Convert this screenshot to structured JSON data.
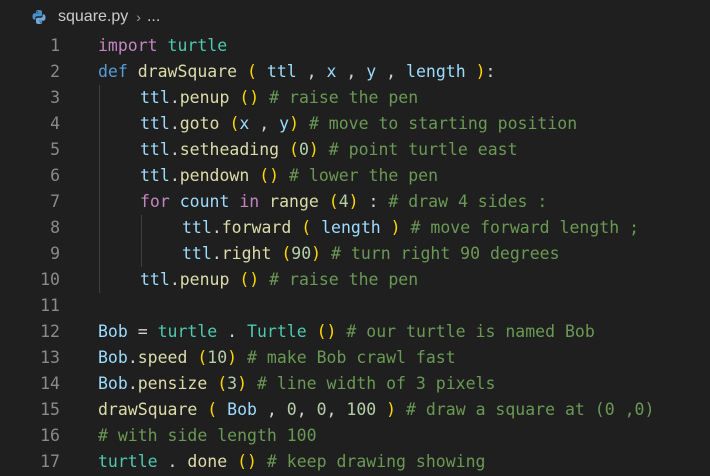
{
  "breadcrumb": {
    "filename": "square.py",
    "separator": "›",
    "more": "..."
  },
  "icons": {
    "file_icon": "python-icon"
  },
  "colors": {
    "background": "#1f1f1f",
    "keyword": "#c586c0",
    "def_keyword": "#569cd6",
    "function": "#dcdcaa",
    "variable": "#9cdcfe",
    "class": "#4ec9b0",
    "number": "#b5cea8",
    "comment": "#6a9955",
    "paren": "#ffd700"
  },
  "lines": [
    {
      "n": "1",
      "tokens": [
        [
          "kw",
          "import"
        ],
        [
          "op",
          " "
        ],
        [
          "mod",
          "turtle"
        ]
      ]
    },
    {
      "n": "2",
      "tokens": [
        [
          "dk",
          "def"
        ],
        [
          "op",
          " "
        ],
        [
          "fn",
          "drawSquare"
        ],
        [
          "op",
          " "
        ],
        [
          "pn",
          "("
        ],
        [
          "op",
          " "
        ],
        [
          "var",
          "ttl"
        ],
        [
          "op",
          " , "
        ],
        [
          "var",
          "x"
        ],
        [
          "op",
          " , "
        ],
        [
          "var",
          "y"
        ],
        [
          "op",
          " , "
        ],
        [
          "var",
          "length"
        ],
        [
          "op",
          " "
        ],
        [
          "pn",
          ")"
        ],
        [
          "op",
          ":"
        ]
      ]
    },
    {
      "n": "3",
      "indent": 1,
      "tokens": [
        [
          "var",
          "ttl"
        ],
        [
          "op",
          "."
        ],
        [
          "fn",
          "penup"
        ],
        [
          "op",
          " "
        ],
        [
          "pn",
          "()"
        ],
        [
          "op",
          " "
        ],
        [
          "cm",
          "# raise the pen"
        ]
      ]
    },
    {
      "n": "4",
      "indent": 1,
      "tokens": [
        [
          "var",
          "ttl"
        ],
        [
          "op",
          "."
        ],
        [
          "fn",
          "goto"
        ],
        [
          "op",
          " "
        ],
        [
          "pn",
          "("
        ],
        [
          "var",
          "x"
        ],
        [
          "op",
          " , "
        ],
        [
          "var",
          "y"
        ],
        [
          "pn",
          ")"
        ],
        [
          "op",
          " "
        ],
        [
          "cm",
          "# move to starting position"
        ]
      ]
    },
    {
      "n": "5",
      "indent": 1,
      "tokens": [
        [
          "var",
          "ttl"
        ],
        [
          "op",
          "."
        ],
        [
          "fn",
          "setheading"
        ],
        [
          "op",
          " "
        ],
        [
          "pn",
          "("
        ],
        [
          "num",
          "0"
        ],
        [
          "pn",
          ")"
        ],
        [
          "op",
          " "
        ],
        [
          "cm",
          "# point turtle east"
        ]
      ]
    },
    {
      "n": "6",
      "indent": 1,
      "tokens": [
        [
          "var",
          "ttl"
        ],
        [
          "op",
          "."
        ],
        [
          "fn",
          "pendown"
        ],
        [
          "op",
          " "
        ],
        [
          "pn",
          "()"
        ],
        [
          "op",
          " "
        ],
        [
          "cm",
          "# lower the pen"
        ]
      ]
    },
    {
      "n": "7",
      "indent": 1,
      "tokens": [
        [
          "kw",
          "for"
        ],
        [
          "op",
          " "
        ],
        [
          "var",
          "count"
        ],
        [
          "op",
          " "
        ],
        [
          "kw",
          "in"
        ],
        [
          "op",
          " "
        ],
        [
          "fn",
          "range"
        ],
        [
          "op",
          " "
        ],
        [
          "pn",
          "("
        ],
        [
          "num",
          "4"
        ],
        [
          "pn",
          ")"
        ],
        [
          "op",
          " : "
        ],
        [
          "cm",
          "# draw 4 sides :"
        ]
      ]
    },
    {
      "n": "8",
      "indent": 2,
      "tokens": [
        [
          "var",
          "ttl"
        ],
        [
          "op",
          "."
        ],
        [
          "fn",
          "forward"
        ],
        [
          "op",
          " "
        ],
        [
          "pn",
          "("
        ],
        [
          "op",
          " "
        ],
        [
          "var",
          "length"
        ],
        [
          "op",
          " "
        ],
        [
          "pn",
          ")"
        ],
        [
          "op",
          " "
        ],
        [
          "cm",
          "# move forward length ;"
        ]
      ]
    },
    {
      "n": "9",
      "indent": 2,
      "tokens": [
        [
          "var",
          "ttl"
        ],
        [
          "op",
          "."
        ],
        [
          "fn",
          "right"
        ],
        [
          "op",
          " "
        ],
        [
          "pn",
          "("
        ],
        [
          "num",
          "90"
        ],
        [
          "pn",
          ")"
        ],
        [
          "op",
          " "
        ],
        [
          "cm",
          "# turn right 90 degrees"
        ]
      ]
    },
    {
      "n": "10",
      "indent": 1,
      "tokens": [
        [
          "var",
          "ttl"
        ],
        [
          "op",
          "."
        ],
        [
          "fn",
          "penup"
        ],
        [
          "op",
          " "
        ],
        [
          "pn",
          "()"
        ],
        [
          "op",
          " "
        ],
        [
          "cm",
          "# raise the pen"
        ]
      ]
    },
    {
      "n": "11",
      "tokens": []
    },
    {
      "n": "12",
      "tokens": [
        [
          "var",
          "Bob"
        ],
        [
          "op",
          " = "
        ],
        [
          "mod",
          "turtle"
        ],
        [
          "op",
          " . "
        ],
        [
          "mod",
          "Turtle"
        ],
        [
          "op",
          " "
        ],
        [
          "pn",
          "()"
        ],
        [
          "op",
          " "
        ],
        [
          "cm",
          "# our turtle is named Bob"
        ]
      ]
    },
    {
      "n": "13",
      "tokens": [
        [
          "var",
          "Bob"
        ],
        [
          "op",
          "."
        ],
        [
          "fn",
          "speed"
        ],
        [
          "op",
          " "
        ],
        [
          "pn",
          "("
        ],
        [
          "num",
          "10"
        ],
        [
          "pn",
          ")"
        ],
        [
          "op",
          " "
        ],
        [
          "cm",
          "# make Bob crawl fast"
        ]
      ]
    },
    {
      "n": "14",
      "tokens": [
        [
          "var",
          "Bob"
        ],
        [
          "op",
          "."
        ],
        [
          "fn",
          "pensize"
        ],
        [
          "op",
          " "
        ],
        [
          "pn",
          "("
        ],
        [
          "num",
          "3"
        ],
        [
          "pn",
          ")"
        ],
        [
          "op",
          " "
        ],
        [
          "cm",
          "# line width of 3 pixels"
        ]
      ]
    },
    {
      "n": "15",
      "tokens": [
        [
          "fn",
          "drawSquare"
        ],
        [
          "op",
          " "
        ],
        [
          "pn",
          "("
        ],
        [
          "op",
          " "
        ],
        [
          "var",
          "Bob"
        ],
        [
          "op",
          " , "
        ],
        [
          "num",
          "0"
        ],
        [
          "op",
          ", "
        ],
        [
          "num",
          "0"
        ],
        [
          "op",
          ", "
        ],
        [
          "num",
          "100"
        ],
        [
          "op",
          " "
        ],
        [
          "pn",
          ")"
        ],
        [
          "op",
          " "
        ],
        [
          "cm",
          "# draw a square at (0 ,0)"
        ]
      ]
    },
    {
      "n": "16",
      "tokens": [
        [
          "cm",
          "# with side length 100"
        ]
      ]
    },
    {
      "n": "17",
      "tokens": [
        [
          "mod",
          "turtle"
        ],
        [
          "op",
          " . "
        ],
        [
          "fn",
          "done"
        ],
        [
          "op",
          " "
        ],
        [
          "pn",
          "()"
        ],
        [
          "op",
          " "
        ],
        [
          "cm",
          "# keep drawing showing"
        ]
      ]
    }
  ]
}
